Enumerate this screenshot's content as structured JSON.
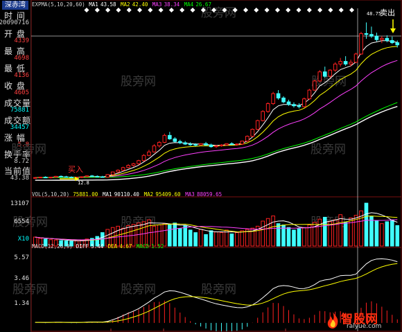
{
  "stock_name": "深赤湾",
  "sidebar": [
    {
      "label": "时 间",
      "value": "20090716",
      "color": "#d0d0d0"
    },
    {
      "label": "开 盘",
      "value": "4339",
      "color": "#ff4040"
    },
    {
      "label": "最 高",
      "value": "4698",
      "color": "#ff4040"
    },
    {
      "label": "最 低",
      "value": "4136",
      "color": "#ff4040"
    },
    {
      "label": "收 盘",
      "value": "4605",
      "color": "#ff4040"
    },
    {
      "label": "成交量",
      "value": "75881",
      "color": "#00ffff"
    },
    {
      "label": "成交额",
      "value": "34457",
      "color": "#00ffff"
    },
    {
      "label": "涨 幅",
      "value": "5.8",
      "color": "#ff4040"
    },
    {
      "label": "换手率",
      "value": "8.72",
      "color": "#d0d0d0"
    },
    {
      "label": "当前值",
      "value": "43.38",
      "color": "#d0d0d0"
    }
  ],
  "watermark": "股旁网",
  "logo": {
    "name": "智股网",
    "url": "ralyue.com"
  },
  "annotations": {
    "buy": "买入",
    "sell": "卖出",
    "high_price": "48.75",
    "low_price": "12.8"
  },
  "colors": {
    "up": "#ff2020",
    "down": "#40ffff",
    "ma1": "#ffffff",
    "ma2": "#ffff00",
    "ma3": "#ff40ff",
    "ma4": "#00ff00",
    "macd_line": "#ffffff",
    "dea_line": "#ffff00"
  },
  "chart_data": [
    {
      "type": "candlestick",
      "legend_title": "EXPMA(5,10,20,60)",
      "legend": [
        {
          "name": "MA1",
          "value": "43.58",
          "color": "#ffffff"
        },
        {
          "name": "MA2",
          "value": "42.40",
          "color": "#ffff00"
        },
        {
          "name": "MA3",
          "value": "38.34",
          "color": "#ff40ff"
        },
        {
          "name": "MA4",
          "value": "26.67",
          "color": "#00ff00"
        }
      ],
      "ylim": [
        9,
        52
      ],
      "candles": [
        [
          13.0,
          13.2,
          12.9,
          13.1
        ],
        [
          13.1,
          13.3,
          13.0,
          13.2
        ],
        [
          13.2,
          13.4,
          13.0,
          13.1
        ],
        [
          13.1,
          13.3,
          12.9,
          13.2
        ],
        [
          13.2,
          13.5,
          13.1,
          13.4
        ],
        [
          13.4,
          13.6,
          13.2,
          13.3
        ],
        [
          13.3,
          13.5,
          13.1,
          13.2
        ],
        [
          13.2,
          13.4,
          13.0,
          13.1
        ],
        [
          13.1,
          13.3,
          12.9,
          13.2
        ],
        [
          13.2,
          13.4,
          13.0,
          13.3
        ],
        [
          13.3,
          13.6,
          13.2,
          13.5
        ],
        [
          13.5,
          13.7,
          13.3,
          13.4
        ],
        [
          13.4,
          13.6,
          13.2,
          13.3
        ],
        [
          13.3,
          13.5,
          13.1,
          13.2
        ],
        [
          13.2,
          13.9,
          13.1,
          13.8
        ],
        [
          13.8,
          14.5,
          13.7,
          14.4
        ],
        [
          14.4,
          15.0,
          14.2,
          14.8
        ],
        [
          14.8,
          15.6,
          14.6,
          15.4
        ],
        [
          15.4,
          16.2,
          15.2,
          15.9
        ],
        [
          15.9,
          16.5,
          15.6,
          16.3
        ],
        [
          16.3,
          17.2,
          16.0,
          17.0
        ],
        [
          17.0,
          18.5,
          16.8,
          18.2
        ],
        [
          18.2,
          19.5,
          18.0,
          19.0
        ],
        [
          19.0,
          20.8,
          18.8,
          20.4
        ],
        [
          20.4,
          21.5,
          20.0,
          21.2
        ],
        [
          21.2,
          23.2,
          21.0,
          22.8
        ],
        [
          22.8,
          23.6,
          21.8,
          22.0
        ],
        [
          22.0,
          22.4,
          21.2,
          21.4
        ],
        [
          21.4,
          21.8,
          20.8,
          21.1
        ],
        [
          21.1,
          21.5,
          20.6,
          20.8
        ],
        [
          20.8,
          21.2,
          20.4,
          20.7
        ],
        [
          20.7,
          21.0,
          20.3,
          20.6
        ],
        [
          20.6,
          21.0,
          20.4,
          20.9
        ],
        [
          20.9,
          21.3,
          20.5,
          20.6
        ],
        [
          20.6,
          20.9,
          20.0,
          20.2
        ],
        [
          20.2,
          20.6,
          19.9,
          20.4
        ],
        [
          20.4,
          20.8,
          20.2,
          20.6
        ],
        [
          20.6,
          21.0,
          20.4,
          20.9
        ],
        [
          20.9,
          21.2,
          20.6,
          20.7
        ],
        [
          20.7,
          21.0,
          20.4,
          20.8
        ],
        [
          20.8,
          21.6,
          20.6,
          21.5
        ],
        [
          21.5,
          22.8,
          21.3,
          22.6
        ],
        [
          22.6,
          24.4,
          22.4,
          24.2
        ],
        [
          24.2,
          26.4,
          24.0,
          26.2
        ],
        [
          26.2,
          28.6,
          26.0,
          28.3
        ],
        [
          28.3,
          30.4,
          28.0,
          30.1
        ],
        [
          30.1,
          32.8,
          29.8,
          32.4
        ],
        [
          32.4,
          33.2,
          31.0,
          31.4
        ],
        [
          31.4,
          31.8,
          30.2,
          30.5
        ],
        [
          30.5,
          31.0,
          29.6,
          29.9
        ],
        [
          29.9,
          30.4,
          29.2,
          29.6
        ],
        [
          29.6,
          30.2,
          29.0,
          29.4
        ],
        [
          29.4,
          31.5,
          29.2,
          31.2
        ],
        [
          31.2,
          33.5,
          31.0,
          33.2
        ],
        [
          33.2,
          35.6,
          33.0,
          35.3
        ],
        [
          35.3,
          37.8,
          35.0,
          37.4
        ],
        [
          37.4,
          38.6,
          36.0,
          36.4
        ],
        [
          36.4,
          38.0,
          36.0,
          37.8
        ],
        [
          37.8,
          39.6,
          37.4,
          39.2
        ],
        [
          39.2,
          40.6,
          38.6,
          39.8
        ],
        [
          39.8,
          41.0,
          38.8,
          39.2
        ],
        [
          39.2,
          40.2,
          38.6,
          39.6
        ],
        [
          39.6,
          41.8,
          39.4,
          41.5
        ],
        [
          41.5,
          46.6,
          41.3,
          46.2
        ],
        [
          46.2,
          48.75,
          45.0,
          46.0
        ],
        [
          46.0,
          47.8,
          45.2,
          45.6
        ],
        [
          45.6,
          46.4,
          44.4,
          44.8
        ],
        [
          44.8,
          45.6,
          44.0,
          45.1
        ],
        [
          45.1,
          45.8,
          44.2,
          44.6
        ],
        [
          44.6,
          45.5,
          43.8,
          44.1
        ],
        [
          44.1,
          44.6,
          43.0,
          43.6
        ]
      ]
    },
    {
      "type": "bar",
      "legend_title": "VOL(5,10,20)",
      "legend": [
        {
          "name": "",
          "value": "75881.00",
          "color": "#ffff00"
        },
        {
          "name": "MA1",
          "value": "90110.40",
          "color": "#ffffff"
        },
        {
          "name": "MA2",
          "value": "95409.60",
          "color": "#ffff00"
        },
        {
          "name": "MA3",
          "value": "88059.65",
          "color": "#ff40ff"
        }
      ],
      "ticks": [
        "13107",
        "6554",
        "X10"
      ],
      "ylim": [
        0,
        14500
      ],
      "values": [
        2800,
        2400,
        2200,
        2000,
        1900,
        1700,
        1600,
        1500,
        1600,
        1800,
        2200,
        2400,
        3000,
        4200,
        5200,
        5800,
        6200,
        5600,
        6400,
        6800,
        7200,
        7600,
        8200,
        6200,
        6600,
        7000,
        6600,
        7200,
        5400,
        6400,
        5000,
        4200,
        5200,
        3600,
        4800,
        4400,
        4200,
        5000,
        3800,
        4200,
        4800,
        5200,
        5600,
        6200,
        7800,
        8600,
        9400,
        7000,
        6600,
        5800,
        5000,
        5400,
        5800,
        6600,
        7400,
        8400,
        9000,
        7600,
        8200,
        9800,
        7400,
        8800,
        9600,
        11000,
        13400,
        9200,
        8000,
        7000,
        7600,
        8200,
        6400
      ]
    },
    {
      "type": "line",
      "legend_title": "MACD(12,26,9)",
      "legend": [
        {
          "name": "DIFF",
          "value": "5.44",
          "color": "#ffffff"
        },
        {
          "name": "DEA",
          "value": "4.67",
          "color": "#ffff00"
        },
        {
          "name": "MACD",
          "value": "1.52",
          "color": "#00ff00"
        }
      ],
      "ticks": [
        "5.57",
        "3.46",
        "1.34"
      ],
      "ylim": [
        -0.5,
        6.4
      ],
      "diff": [
        0.05,
        0.05,
        0.04,
        0.05,
        0.06,
        0.06,
        0.05,
        0.04,
        0.04,
        0.05,
        0.07,
        0.08,
        0.08,
        0.07,
        0.14,
        0.28,
        0.45,
        0.65,
        0.86,
        1.05,
        1.27,
        1.56,
        1.86,
        2.2,
        2.46,
        2.75,
        2.86,
        2.83,
        2.72,
        2.58,
        2.42,
        2.26,
        2.13,
        1.99,
        1.83,
        1.7,
        1.6,
        1.52,
        1.43,
        1.36,
        1.35,
        1.42,
        1.6,
        1.88,
        2.24,
        2.63,
        3.05,
        3.26,
        3.32,
        3.28,
        3.18,
        3.05,
        3.06,
        3.18,
        3.4,
        3.7,
        3.82,
        3.88,
        4.04,
        4.2,
        4.23,
        4.23,
        4.33,
        4.8,
        5.25,
        5.55,
        5.68,
        5.7,
        5.66,
        5.58,
        5.44
      ],
      "dea": [
        0.05,
        0.05,
        0.05,
        0.05,
        0.05,
        0.05,
        0.05,
        0.05,
        0.05,
        0.05,
        0.05,
        0.06,
        0.06,
        0.06,
        0.08,
        0.12,
        0.18,
        0.27,
        0.39,
        0.52,
        0.67,
        0.85,
        1.05,
        1.28,
        1.52,
        1.76,
        1.98,
        2.15,
        2.26,
        2.32,
        2.34,
        2.32,
        2.29,
        2.24,
        2.16,
        2.07,
        1.98,
        1.89,
        1.8,
        1.71,
        1.64,
        1.59,
        1.59,
        1.65,
        1.77,
        1.94,
        2.16,
        2.38,
        2.57,
        2.71,
        2.8,
        2.85,
        2.89,
        2.95,
        3.04,
        3.17,
        3.3,
        3.41,
        3.54,
        3.68,
        3.78,
        3.87,
        3.96,
        4.13,
        4.35,
        4.59,
        4.81,
        4.98,
        5.11,
        5.22,
        5.28
      ]
    }
  ]
}
